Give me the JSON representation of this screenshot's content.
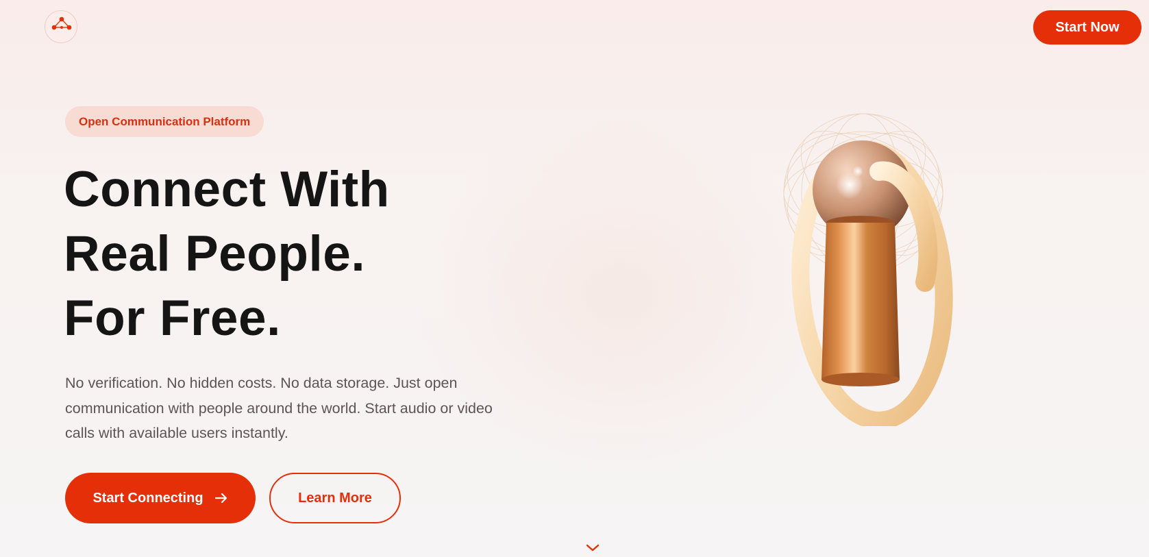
{
  "header": {
    "logo_icon": "network-nodes-icon",
    "cta_label": "Start Now"
  },
  "hero": {
    "badge": "Open Communication Platform",
    "headline_lines": [
      "Connect With",
      "Real People.",
      "For Free."
    ],
    "description": "No verification. No hidden costs. No data storage. Just open communication with people around the world. Start audio or video calls with available users instantly.",
    "primary_button": "Start Connecting",
    "primary_button_icon": "arrow-right-icon",
    "secondary_button": "Learn More",
    "scroll_icon": "chevron-down-icon",
    "illustration": "microphone-ring-illustration"
  },
  "colors": {
    "accent": "#e52f08",
    "badge_bg": "#f8dbd3",
    "headline": "#151515",
    "body_text": "#5c5555",
    "copper": "#c8743a",
    "ring": "#f6d8a8"
  }
}
